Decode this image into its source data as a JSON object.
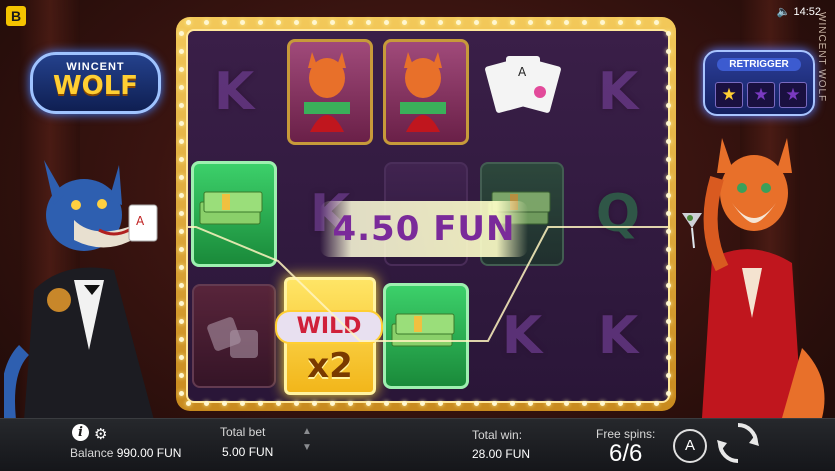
{
  "app": {
    "menu_icon_label": "B"
  },
  "logo": {
    "line1": "WINCENT",
    "line2": "WOLF"
  },
  "retrigger": {
    "label": "RETRIGGER",
    "stars_lit": 1,
    "stars_total": 3
  },
  "status": {
    "time": "14:52",
    "vertical_title": "WINCENT WOLF"
  },
  "win_banner": {
    "text": "4.50 FUN"
  },
  "reels": {
    "cells": [
      {
        "symbol": "K",
        "kind": "letter"
      },
      {
        "symbol": "fox",
        "kind": "fox"
      },
      {
        "symbol": "fox",
        "kind": "fox"
      },
      {
        "symbol": "cards",
        "kind": "cards"
      },
      {
        "symbol": "K",
        "kind": "letter"
      },
      {
        "symbol": "money",
        "kind": "money"
      },
      {
        "symbol": "K",
        "kind": "letter"
      },
      {
        "symbol": "cards",
        "kind": "cards-dim"
      },
      {
        "symbol": "money",
        "kind": "money-dim"
      },
      {
        "symbol": "Q",
        "kind": "letter-green"
      },
      {
        "symbol": "dice",
        "kind": "dice"
      },
      {
        "symbol": "WILD x2",
        "kind": "wild"
      },
      {
        "symbol": "money",
        "kind": "money"
      },
      {
        "symbol": "K",
        "kind": "letter"
      },
      {
        "symbol": "K",
        "kind": "letter"
      }
    ],
    "wild": {
      "word": "WILD",
      "multiplier": "x2"
    }
  },
  "bottom": {
    "balance_label": "Balance",
    "balance_value": "990.00 FUN",
    "total_bet_label": "Total bet",
    "total_bet_value": "5.00 FUN",
    "total_win_label": "Total win:",
    "total_win_value": "28.00 FUN",
    "free_spins_label": "Free spins:",
    "free_spins_value": "6/6",
    "autoplay_label": "A"
  },
  "colors": {
    "accent_gold": "#f3c95a",
    "banner_text": "#7a2a9a",
    "wild_text": "#d0203a"
  }
}
